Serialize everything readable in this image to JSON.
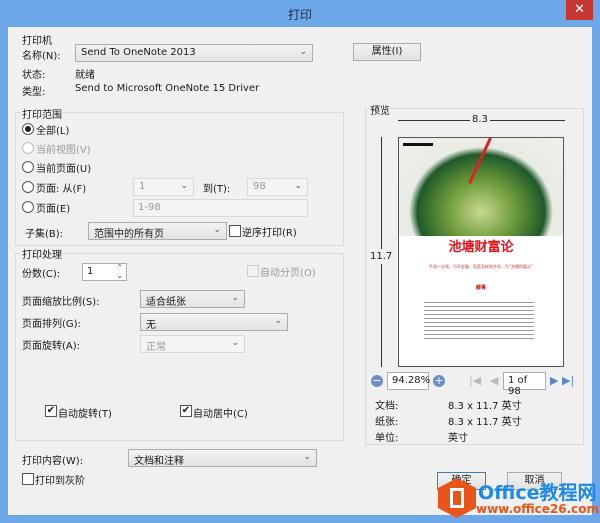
{
  "window": {
    "title": "打印",
    "close": "✕"
  },
  "printer": {
    "group": "打印机",
    "name_label": "名称(N):",
    "name_value": "Send To OneNote 2013",
    "properties": "属性(I)",
    "status_label": "状态:",
    "status_value": "就绪",
    "type_label": "类型:",
    "type_value": "Send to Microsoft OneNote 15 Driver"
  },
  "range": {
    "group": "打印范围",
    "all": "全部(L)",
    "current_view": "当前视图(V)",
    "current_page": "当前页面(U)",
    "pages_from": "页面: 从(F)",
    "from_value": "1",
    "to_label": "到(T):",
    "to_value": "98",
    "pages": "页面(E)",
    "pages_value": "1-98",
    "subset_label": "子集(B):",
    "subset_value": "范围中的所有页",
    "reverse": "逆序打印(R)"
  },
  "handling": {
    "group": "打印处理",
    "copies_label": "份数(C):",
    "copies_value": "1",
    "collate": "自动分页(O)",
    "scale_label": "页面缩放比例(S):",
    "scale_value": "适合纸张",
    "arrange_label": "页面排列(G):",
    "arrange_value": "无",
    "rotate_label": "页面旋转(A):",
    "rotate_value": "正常",
    "auto_rotate": "自动旋转(T)",
    "auto_center": "自动居中(C)"
  },
  "content": {
    "label": "打印内容(W):",
    "value": "文档和注释",
    "grayscale": "打印到灰阶"
  },
  "preview": {
    "group": "预览",
    "width": "8.3",
    "height": "11.7",
    "zoom": "94.28%",
    "page": "1 of 98",
    "doc_title": "池塘财富论",
    "doc_subtitle": "平流一分钱，为开金融，而是怎样经济学，为“池塘财富论”",
    "doc_author": "薛青",
    "doc_label": "文档:",
    "doc_value": "8.3 x 11.7 英寸",
    "paper_label": "纸张:",
    "paper_value": "8.3 x 11.7 英寸",
    "unit_label": "单位:",
    "unit_value": "英寸"
  },
  "buttons": {
    "ok": "确定",
    "cancel": "取消"
  },
  "watermark": {
    "brand": "Office教程网",
    "url": "www.office26.com"
  },
  "colors": {
    "titlebar": "#6ea7e8",
    "close": "#c7372f",
    "title_red": "#e0141b",
    "watermark": "#1e88e5",
    "logo": "#e8541a"
  }
}
